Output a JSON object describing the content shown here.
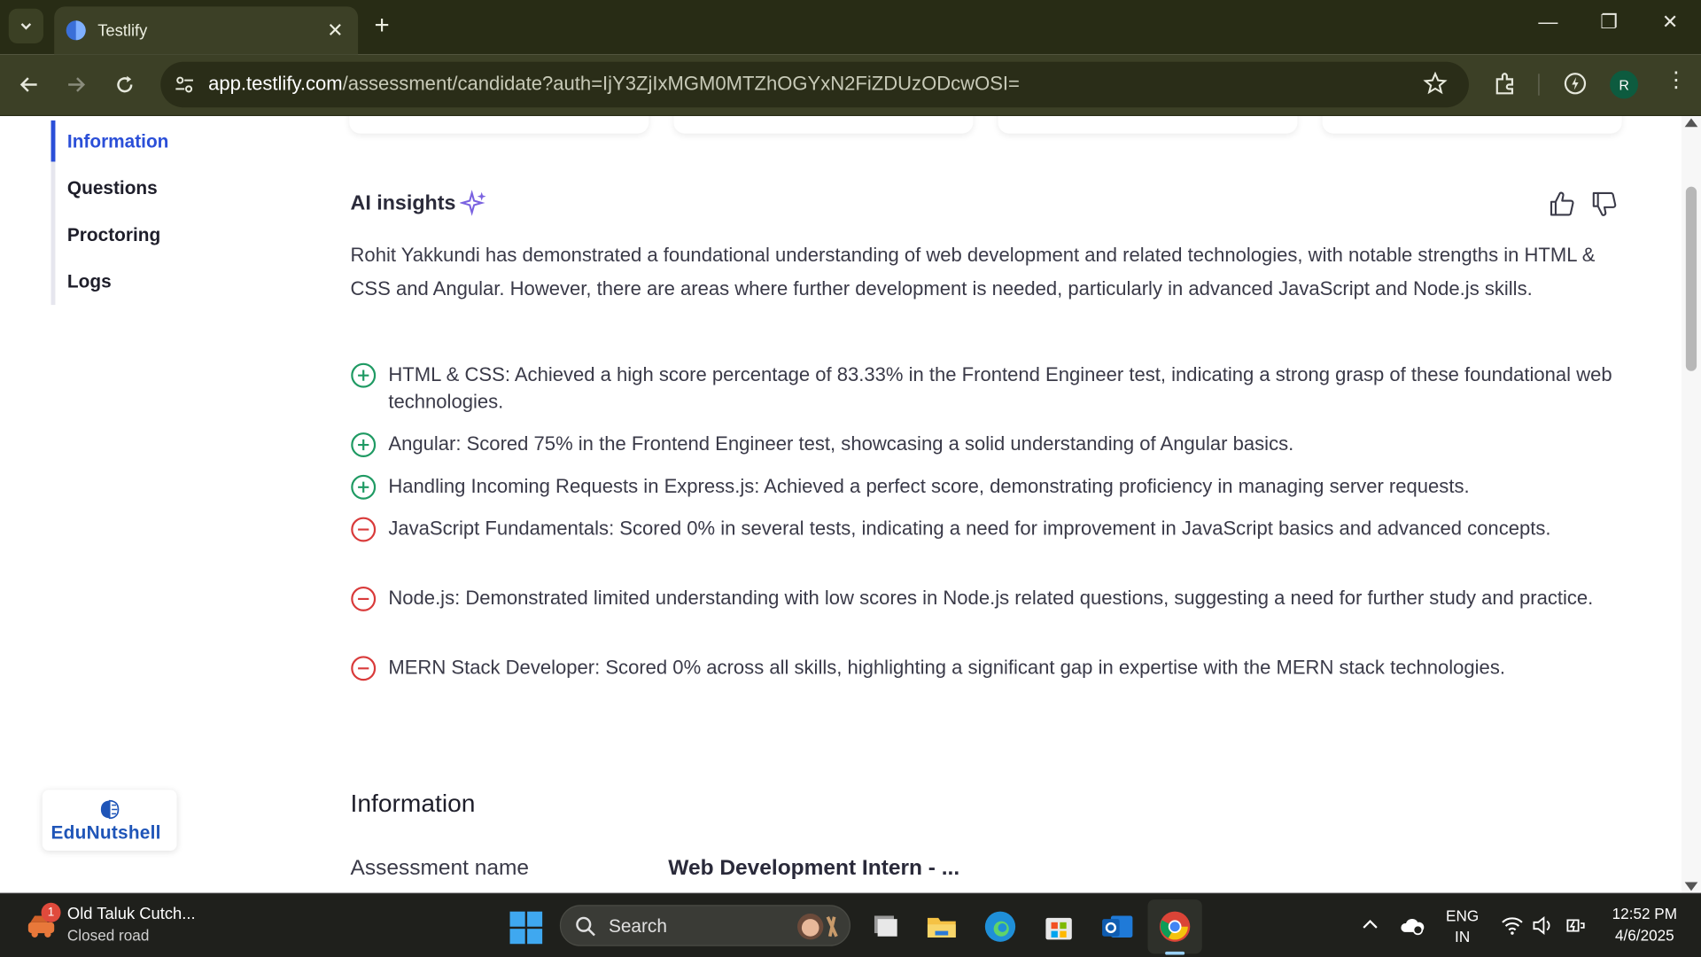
{
  "browser": {
    "tab_title": "Testlify",
    "url_host": "app.testlify.com",
    "url_path": "/assessment/candidate?auth=IjY3ZjIxMGM0MTZhOGYxN2FiZDUzODcwOSI=",
    "profile_initial": "R"
  },
  "sidebar": {
    "items": [
      {
        "label": "Information",
        "active": true
      },
      {
        "label": "Questions",
        "active": false
      },
      {
        "label": "Proctoring",
        "active": false
      },
      {
        "label": "Logs",
        "active": false
      }
    ],
    "logo_text": "EduNutshell"
  },
  "ai_insights": {
    "title": "AI insights",
    "summary": "Rohit Yakkundi has demonstrated a foundational understanding of web development and related technologies, with notable strengths in HTML & CSS and Angular. However, there are areas where further development is needed, particularly in advanced JavaScript and Node.js skills.",
    "items": [
      {
        "type": "positive",
        "text": "HTML & CSS: Achieved a high score percentage of 83.33% in the Frontend Engineer test, indicating a strong grasp of these foundational web technologies."
      },
      {
        "type": "positive",
        "text": "Angular: Scored 75% in the Frontend Engineer test, showcasing a solid understanding of Angular basics."
      },
      {
        "type": "positive",
        "text": "Handling Incoming Requests in Express.js: Achieved a perfect score, demonstrating proficiency in managing server requests."
      },
      {
        "type": "negative",
        "text": "JavaScript Fundamentals: Scored 0% in several tests, indicating a need for improvement in JavaScript basics and advanced concepts."
      },
      {
        "type": "negative",
        "text": "Node.js: Demonstrated limited understanding with low scores in Node.js related questions, suggesting a need for further study and practice."
      },
      {
        "type": "negative",
        "text": "MERN Stack Developer: Scored 0% across all skills, highlighting a significant gap in expertise with the MERN stack technologies."
      }
    ],
    "positive_color": "#1f9a63",
    "negative_color": "#d93a3a"
  },
  "information": {
    "heading": "Information",
    "assessment_label": "Assessment name",
    "assessment_value": "Web Development Intern - ..."
  },
  "taskbar": {
    "weather_title": "Old Taluk Cutch...",
    "weather_sub": "Closed road",
    "weather_badge": "1",
    "search_placeholder": "Search",
    "lang_top": "ENG",
    "lang_bottom": "IN",
    "time": "12:52 PM",
    "date": "4/6/2025"
  },
  "colors": {
    "accent": "#2b4fd8",
    "chrome_bg": "#282c15",
    "toolbar_bg": "#3c4026"
  }
}
